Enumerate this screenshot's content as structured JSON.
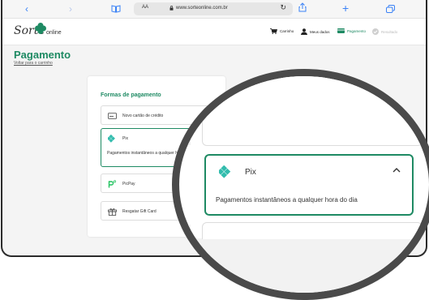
{
  "browser": {
    "text_size_label": "AA",
    "url": "www.sorteonline.com.br"
  },
  "header": {
    "logo_word": "Sorte",
    "logo_sub": "online",
    "nav": [
      {
        "label": "Carrinho",
        "icon": "cart-icon",
        "state": "normal"
      },
      {
        "label": "Meus dados",
        "icon": "user-icon",
        "state": "normal"
      },
      {
        "label": "Pagamento",
        "icon": "card-icon",
        "state": "active"
      },
      {
        "label": "Resultado",
        "icon": "check-circle-icon",
        "state": "disabled"
      }
    ]
  },
  "page": {
    "title": "Pagamento",
    "back_link": "Voltar para o carrinho"
  },
  "payment": {
    "section_title": "Formas de pagamento",
    "options": [
      {
        "label": "Novo cartão de crédito",
        "icon": "credit-card-icon"
      },
      {
        "label": "Pix",
        "icon": "pix-icon",
        "selected": true,
        "description": "Pagamentos instantâneos a qualquer hora do dia"
      },
      {
        "label": "PicPay",
        "icon": "picpay-icon"
      },
      {
        "label": "Resgatar Gift Card",
        "icon": "gift-icon"
      }
    ]
  },
  "magnified": {
    "label": "Pix",
    "description": "Pagamentos instantâneos a qualquer hora do dia"
  },
  "colors": {
    "brand_green": "#1e8a63",
    "ios_blue": "#3b82f6",
    "magnifier_ring": "#4a4a4a"
  }
}
